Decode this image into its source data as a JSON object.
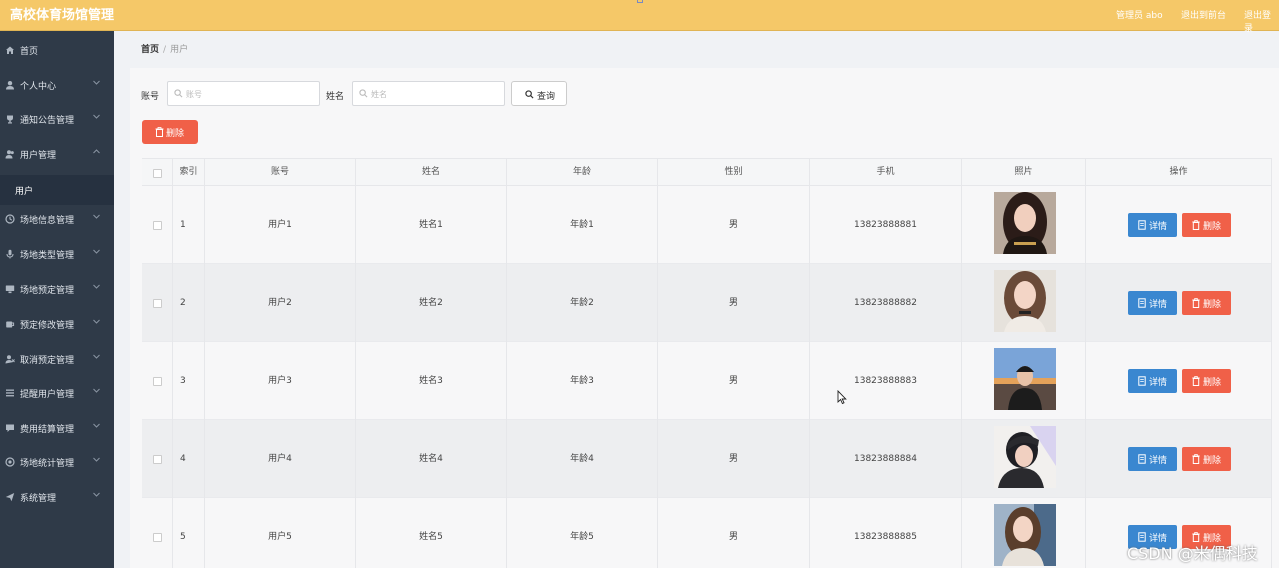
{
  "header": {
    "title": "高校体育场馆管理",
    "admin": "管理员 abo",
    "link_back": "退出到前台",
    "link_logout": "退出登录"
  },
  "sidebar": {
    "items": [
      {
        "label": "首页",
        "icon": "home-icon"
      },
      {
        "label": "个人中心",
        "icon": "user-icon"
      },
      {
        "label": "通知公告管理",
        "icon": "trophy-icon"
      },
      {
        "label": "用户管理",
        "icon": "user-group-icon",
        "expanded": true
      },
      {
        "label": "场地信息管理",
        "icon": "clock-icon"
      },
      {
        "label": "场地类型管理",
        "icon": "mic-icon"
      },
      {
        "label": "场地预定管理",
        "icon": "monitor-icon"
      },
      {
        "label": "预定修改管理",
        "icon": "mug-icon"
      },
      {
        "label": "取消预定管理",
        "icon": "user-x-icon"
      },
      {
        "label": "提醒用户管理",
        "icon": "list-icon"
      },
      {
        "label": "费用结算管理",
        "icon": "chat-icon"
      },
      {
        "label": "场地统计管理",
        "icon": "chart-icon"
      },
      {
        "label": "系统管理",
        "icon": "send-icon"
      }
    ],
    "sub_item": "用户"
  },
  "breadcrumb": {
    "home": "首页",
    "sep": "/",
    "current": "用户"
  },
  "filters": {
    "account_label": "账号",
    "account_placeholder": "账号",
    "name_label": "姓名",
    "name_placeholder": "姓名",
    "query": "查询"
  },
  "actions": {
    "delete": "删除"
  },
  "table": {
    "columns": [
      "索引",
      "账号",
      "姓名",
      "年龄",
      "性别",
      "手机",
      "照片",
      "操作"
    ],
    "detail_label": "详情",
    "delete_label": "删除",
    "rows": [
      {
        "index": "1",
        "account": "用户1",
        "name": "姓名1",
        "age": "年龄1",
        "gender": "男",
        "phone": "13823888881",
        "photo": "photo-1"
      },
      {
        "index": "2",
        "account": "用户2",
        "name": "姓名2",
        "age": "年龄2",
        "gender": "男",
        "phone": "13823888882",
        "photo": "photo-2"
      },
      {
        "index": "3",
        "account": "用户3",
        "name": "姓名3",
        "age": "年龄3",
        "gender": "男",
        "phone": "13823888883",
        "photo": "photo-3"
      },
      {
        "index": "4",
        "account": "用户4",
        "name": "姓名4",
        "age": "年龄4",
        "gender": "男",
        "phone": "13823888884",
        "photo": "photo-4"
      },
      {
        "index": "5",
        "account": "用户5",
        "name": "姓名5",
        "age": "年龄5",
        "gender": "男",
        "phone": "13823888885",
        "photo": "photo-5"
      }
    ]
  },
  "watermark": "CSDN @米偶科技",
  "colors": {
    "header": "#f5c868",
    "sidebar": "#2f3a48",
    "primary": "#3a87d0",
    "danger": "#f06048"
  }
}
